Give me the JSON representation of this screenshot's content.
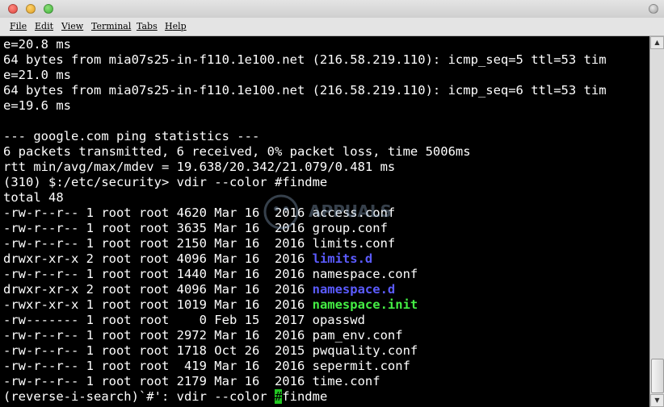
{
  "window": {
    "menu": [
      {
        "key": "F",
        "rest": "ile"
      },
      {
        "key": "E",
        "rest": "dit"
      },
      {
        "key": "V",
        "rest": "iew"
      },
      {
        "key": "T",
        "rest": "erminal"
      },
      {
        "key": "T",
        "rest": "abs"
      },
      {
        "key": "H",
        "rest": "elp"
      }
    ]
  },
  "terminal": {
    "lines": {
      "l0": "e=20.8 ms",
      "l1": "64 bytes from mia07s25-in-f110.1e100.net (216.58.219.110): icmp_seq=5 ttl=53 tim",
      "l2": "e=21.0 ms",
      "l3": "64 bytes from mia07s25-in-f110.1e100.net (216.58.219.110): icmp_seq=6 ttl=53 tim",
      "l4": "e=19.6 ms",
      "l5": "",
      "l6": "--- google.com ping statistics ---",
      "l7": "6 packets transmitted, 6 received, 0% packet loss, time 5006ms",
      "l8": "rtt min/avg/max/mdev = 19.638/20.342/21.079/0.481 ms",
      "l9": "(310) $:/etc/security> vdir --color #findme",
      "l10": "total 48"
    },
    "listing": [
      {
        "meta": "-rw-r--r-- 1 root root 4620 Mar 16  2016 ",
        "name": "access.conf",
        "type": "file"
      },
      {
        "meta": "-rw-r--r-- 1 root root 3635 Mar 16  2016 ",
        "name": "group.conf",
        "type": "file"
      },
      {
        "meta": "-rw-r--r-- 1 root root 2150 Mar 16  2016 ",
        "name": "limits.conf",
        "type": "file"
      },
      {
        "meta": "drwxr-xr-x 2 root root 4096 Mar 16  2016 ",
        "name": "limits.d",
        "type": "dir"
      },
      {
        "meta": "-rw-r--r-- 1 root root 1440 Mar 16  2016 ",
        "name": "namespace.conf",
        "type": "file"
      },
      {
        "meta": "drwxr-xr-x 2 root root 4096 Mar 16  2016 ",
        "name": "namespace.d",
        "type": "dir"
      },
      {
        "meta": "-rwxr-xr-x 1 root root 1019 Mar 16  2016 ",
        "name": "namespace.init",
        "type": "exe"
      },
      {
        "meta": "-rw------- 1 root root    0 Feb 15  2017 ",
        "name": "opasswd",
        "type": "file"
      },
      {
        "meta": "-rw-r--r-- 1 root root 2972 Mar 16  2016 ",
        "name": "pam_env.conf",
        "type": "file"
      },
      {
        "meta": "-rw-r--r-- 1 root root 1718 Oct 26  2015 ",
        "name": "pwquality.conf",
        "type": "file"
      },
      {
        "meta": "-rw-r--r-- 1 root root  419 Mar 16  2016 ",
        "name": "sepermit.conf",
        "type": "file"
      },
      {
        "meta": "-rw-r--r-- 1 root root 2179 Mar 16  2016 ",
        "name": "time.conf",
        "type": "file"
      }
    ],
    "search": {
      "prefix": "(reverse-i-search)`#': vdir --color ",
      "cursor_char": "#",
      "suffix": "findme"
    },
    "colors": {
      "background": "#000000",
      "foreground": "#ffffff",
      "directory": "#5b5bff",
      "executable": "#44ee44",
      "cursor": "#22c922"
    }
  },
  "watermark": {
    "text": "APPUALS"
  },
  "scrollbar": {
    "position": 1.0
  }
}
